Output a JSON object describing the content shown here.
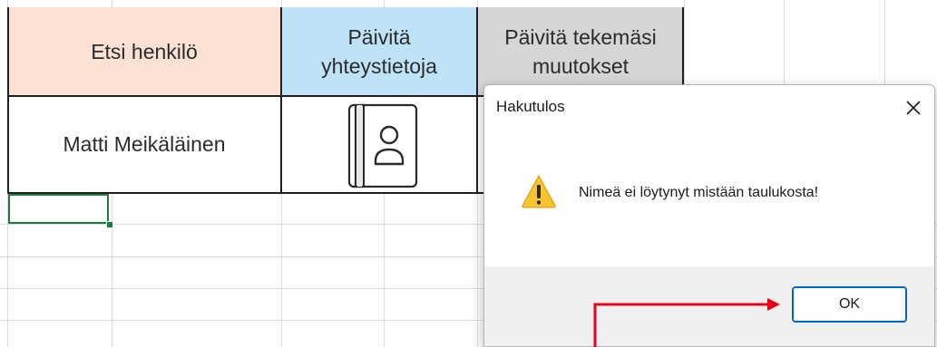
{
  "spreadsheet": {
    "header_search": "Etsi henkilö",
    "header_update_line1": "Päivitä",
    "header_update_line2": "yhteystietoja",
    "header_changes_line1": "Päivitä tekemäsi",
    "header_changes_line2": "muutokset",
    "name_value": "Matti Meikäläinen",
    "contact_icon": "contact-book-icon"
  },
  "dialog": {
    "title": "Hakutulos",
    "close_symbol": "✕",
    "icon": "warning-icon",
    "message": "Nimeä ei löytynyt mistään taulukosta!",
    "ok_label": "OK"
  },
  "colors": {
    "search_header_bg": "#fbe1d4",
    "update_header_bg": "#bfe3f6",
    "changes_header_bg": "#d6d6d6",
    "selection_green": "#1f7a3f",
    "warning_yellow": "#f7c430",
    "annotation_red": "#e8001c",
    "button_focus_blue": "#0067c0"
  }
}
